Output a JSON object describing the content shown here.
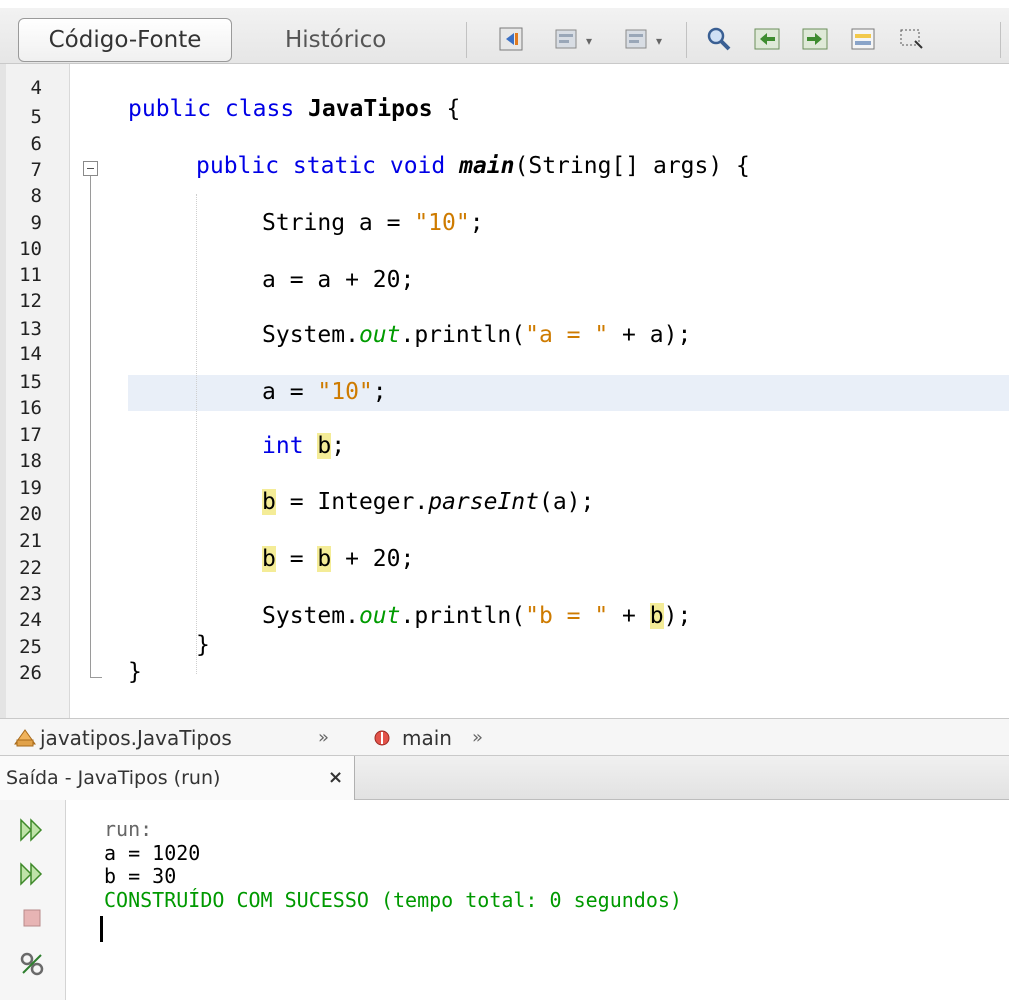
{
  "toolbar": {
    "tab_source": "Código-Fonte",
    "tab_history": "Histórico",
    "icons": [
      "last-edit-icon",
      "back-icon",
      "forward-icon",
      "find-icon",
      "find-previous-icon",
      "find-next-icon",
      "toggle-highlight-icon",
      "rectangular-selection-icon"
    ]
  },
  "editor": {
    "line_numbers": [
      "4",
      "5",
      "6",
      "7",
      "8",
      "9",
      "10",
      "11",
      "12",
      "13",
      "14",
      "15",
      "16",
      "17",
      "18",
      "19",
      "20",
      "21",
      "22",
      "23",
      "24",
      "25",
      "26"
    ],
    "line5": {
      "kw": "public class ",
      "cls": "JavaTipos",
      "rest": " {"
    },
    "line7": {
      "kw": "public static void ",
      "mth": "main",
      "rest": "(String[] args) {"
    },
    "line9": {
      "pre": "String a = ",
      "str": "\"10\"",
      "post": ";"
    },
    "line11": {
      "text": "a = a + 20;"
    },
    "line13": {
      "pre": "System.",
      "fld": "out",
      "mid": ".println(",
      "str": "\"a = \"",
      "post": " + a);"
    },
    "line15": {
      "pre": "a = ",
      "str": "\"10\"",
      "post": ";"
    },
    "line17": {
      "kw": "int ",
      "var": "b",
      "post": ";"
    },
    "line19": {
      "var": "b",
      "mid": " = Integer.",
      "stat": "parseInt",
      "post": "(a);"
    },
    "line21": {
      "var1": "b",
      "mid": " = ",
      "var2": "b",
      "post": " + 20;"
    },
    "line23": {
      "pre": "System.",
      "fld": "out",
      "mid": ".println(",
      "str": "\"b = \"",
      "post2": " + ",
      "var": "b",
      "post": ");"
    },
    "line24": {
      "text": "}"
    },
    "line25": {
      "text": "}"
    }
  },
  "breadcrumb": {
    "class_path": "javatipos.JavaTipos",
    "method": "main",
    "separator": "»"
  },
  "output": {
    "tab_label": "Saída - JavaTipos (run)",
    "close_symbol": "×",
    "lines": [
      "run:",
      "a = 1020",
      "b = 30",
      "CONSTRUÍDO COM SUCESSO (tempo total: 0 segundos)"
    ],
    "colors": {
      "normal": "#000000",
      "muted": "#666666",
      "success": "#009900"
    }
  }
}
